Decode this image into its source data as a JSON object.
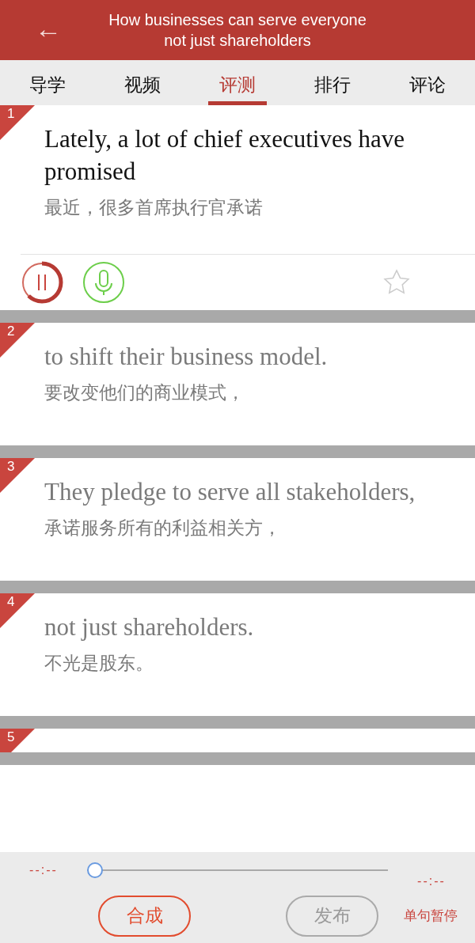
{
  "header": {
    "back": "←",
    "title": "How businesses can serve everyone not just shareholders"
  },
  "tabs": [
    {
      "label": "导学",
      "selected": false
    },
    {
      "label": "视频",
      "selected": false
    },
    {
      "label": "评测",
      "selected": true
    },
    {
      "label": "排行",
      "selected": false
    },
    {
      "label": "评论",
      "selected": false
    }
  ],
  "sentences": [
    {
      "number": "1",
      "english": "Lately, a lot of chief executives have promised",
      "chinese": "最近，很多首席执行官承诺",
      "selected": true,
      "level": 0.62,
      "starred": false
    },
    {
      "number": "2",
      "english": "to shift their business model.",
      "chinese": "要改变他们的商业模式，",
      "selected": false
    },
    {
      "number": "3",
      "english": "They pledge to serve all stakeholders,",
      "chinese": "承诺服务所有的利益相关方，",
      "selected": false
    },
    {
      "number": "4",
      "english": "not just shareholders.",
      "chinese": "不光是股东。",
      "selected": false
    },
    {
      "number": "5",
      "selected": false
    }
  ],
  "player": {
    "elapsed": "--:--",
    "total": "--:--",
    "level": 0
  },
  "buttons": [
    {
      "label": "合成",
      "disabled": false
    },
    {
      "label": "发布",
      "disabled": true
    }
  ],
  "pause_toggle": "单句暂停"
}
